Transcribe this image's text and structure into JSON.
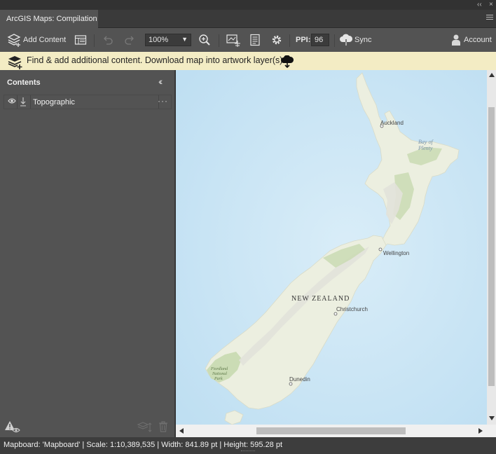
{
  "window": {
    "tab_title": "ArcGIS Maps: Compilation",
    "collapse_glyph": "‹‹",
    "close_glyph": "×"
  },
  "toolbar": {
    "add_content_label": "Add Content",
    "zoom_value": "100%",
    "ppi_label": "PPI:",
    "ppi_value": "96",
    "sync_label": "Sync",
    "account_label": "Account"
  },
  "banner": {
    "message": "Find & add additional content. Download map into artwork layer(s)"
  },
  "sidebar": {
    "title": "Contents",
    "layers": [
      {
        "name": "Topographic",
        "visible": true
      }
    ],
    "more_glyph": "···"
  },
  "map": {
    "labels": {
      "auckland": "Auckland",
      "bay_of_plenty_1": "Bay of",
      "bay_of_plenty_2": "Plenty",
      "wellington": "Wellington",
      "new_zealand": "NEW ZEALAND",
      "christchurch": "Christchurch",
      "dunedin": "Dunedin",
      "fiordland_1": "Fiordland",
      "fiordland_2": "National",
      "fiordland_3": "Park"
    },
    "colors": {
      "ocean": "#cfe6f5",
      "land": "#ecefe0",
      "forest": "#c8d9b0",
      "mountain": "#e2e2da"
    }
  },
  "status": {
    "text": "Mapboard: 'Mapboard' | Scale: 1:10,389,535  | Width: 841.89 pt | Height: 595.28 pt"
  }
}
